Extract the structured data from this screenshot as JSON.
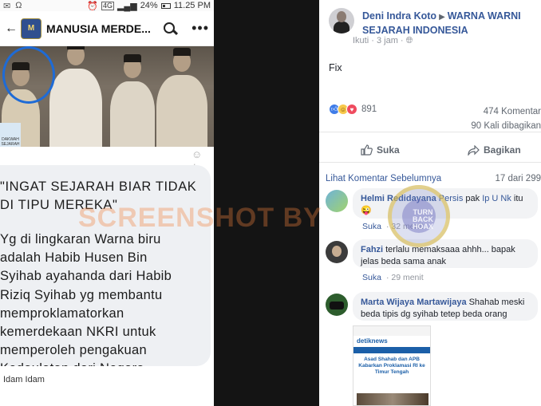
{
  "left": {
    "status": {
      "battery": "24%",
      "time": "11.25 PM",
      "network": "4G"
    },
    "group_name": "MANUSIA MERDE...",
    "photo_badge": "DAKWAH SEJARAH",
    "quote": "\"INGAT SEJARAH BIAR TIDAK\nDI TIPU MEREKA\"",
    "body": "Yg di lingkaran Warna biru\nadalah Habib Husen Bin\nSyihab ayahanda dari Habib\nRiziq Syihab yg membantu\nmemproklamatorkan\nkemerdekaan NKRI untuk\nmemperoleh pengakuan\nKedaulatan dari Negara",
    "author": "Idam Idam"
  },
  "watermark": "SCREENSHOT BY",
  "seal": {
    "text": "TURN BACK HOAX"
  },
  "right": {
    "poster": "Deni Indra Koto",
    "group": "WARNA WARNI SEJARAH INDONESIA",
    "meta_follow": "Ikuti",
    "meta_time": "3 jam",
    "post_text": "Fix",
    "reaction_count": "891",
    "comments_count": "474 Komentar",
    "shares_count": "90 Kali dibagikan",
    "like_label": "Suka",
    "share_label": "Bagikan",
    "prev_comments": "Lihat Komentar Sebelumnya",
    "comment_counter": "17 dari 299",
    "comments": [
      {
        "name": "Helmi Redidayana",
        "tag": "Persis",
        "text_mid": " pak ",
        "tag2": "Ip U Nk",
        "text_end": " itu 😜",
        "like": "Suka",
        "time": "32 menit"
      },
      {
        "name": "Fahzi",
        "text": "terlalu memaksaaa ahhh... bapak jelas beda sama anak",
        "like": "Suka",
        "time": "29 menit"
      },
      {
        "name": "Marta Wijaya Martawijaya",
        "text": "Shahab meski beda tipis dg syihab tetep beda orang"
      }
    ],
    "thumb": {
      "site": "detiknews",
      "title": "Asad Shahab dan APB Kabarkan Proklamasi RI ke Timur Tengah"
    }
  }
}
